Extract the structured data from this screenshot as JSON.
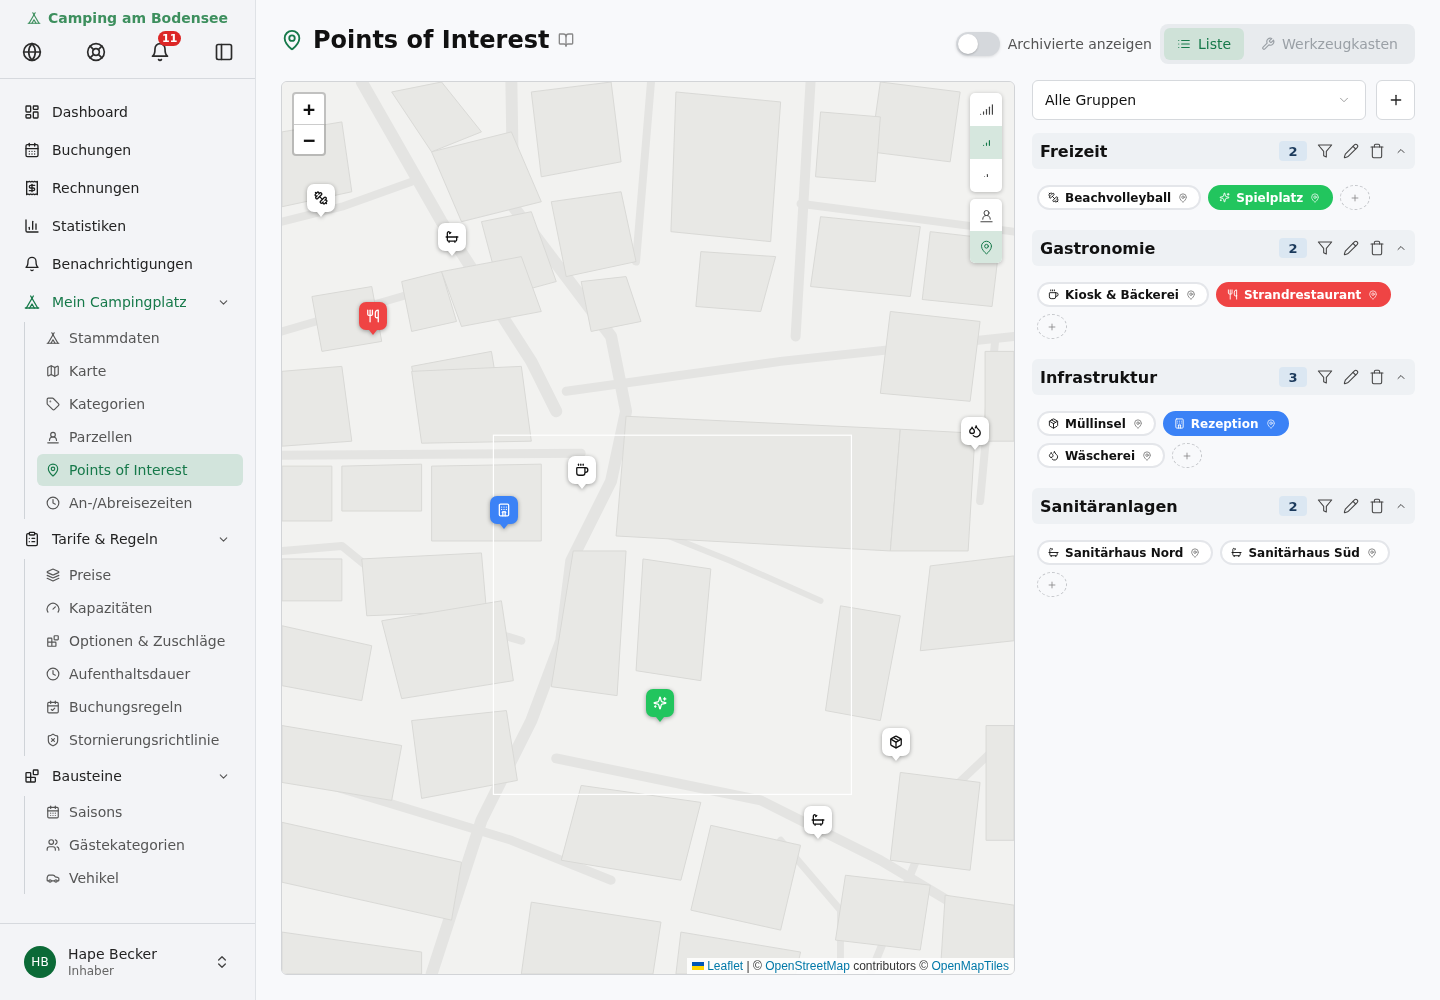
{
  "sidebar": {
    "brand": "Camping am Bodensee",
    "notification_count": "11",
    "nav": [
      {
        "label": "Dashboard",
        "selected": false
      },
      {
        "label": "Buchungen",
        "selected": false
      },
      {
        "label": "Rechnungen",
        "selected": false
      },
      {
        "label": "Statistiken",
        "selected": false
      },
      {
        "label": "Benachrichtigungen",
        "selected": false
      },
      {
        "label": "Mein Campingplatz",
        "selected": true,
        "expanded": true,
        "children": [
          {
            "label": "Stammdaten",
            "selected": false
          },
          {
            "label": "Karte",
            "selected": false
          },
          {
            "label": "Kategorien",
            "selected": false
          },
          {
            "label": "Parzellen",
            "selected": false
          },
          {
            "label": "Points of Interest",
            "selected": true
          },
          {
            "label": "An-/Abreisezeiten",
            "selected": false
          }
        ]
      },
      {
        "label": "Tarife & Regeln",
        "selected": false,
        "expanded": true,
        "children": [
          {
            "label": "Preise",
            "selected": false
          },
          {
            "label": "Kapazitäten",
            "selected": false
          },
          {
            "label": "Optionen & Zuschläge",
            "selected": false
          },
          {
            "label": "Aufenthaltsdauer",
            "selected": false
          },
          {
            "label": "Buchungsregeln",
            "selected": false
          },
          {
            "label": "Stornierungsrichtlinie",
            "selected": false
          }
        ]
      },
      {
        "label": "Bausteine",
        "selected": false,
        "expanded": true,
        "children": [
          {
            "label": "Saisons",
            "selected": false
          },
          {
            "label": "Gästekategorien",
            "selected": false
          },
          {
            "label": "Vehikel",
            "selected": false
          }
        ]
      }
    ],
    "user": {
      "initials": "HB",
      "name": "Hape Becker",
      "role": "Inhaber"
    }
  },
  "header": {
    "title": "Points of Interest",
    "archived_toggle": {
      "label": "Archivierte anzeigen",
      "on": false
    },
    "views": [
      {
        "label": "Liste",
        "selected": true
      },
      {
        "label": "Werkzeugkasten",
        "selected": false
      }
    ]
  },
  "map": {
    "zoom_in": "+",
    "zoom_out": "−",
    "detail_levels": [
      {
        "selected": false
      },
      {
        "selected": true
      },
      {
        "selected": false
      }
    ],
    "layers": [
      {
        "selected": false
      },
      {
        "selected": true
      }
    ],
    "markers": [
      {
        "color": "#ffffff"
      },
      {
        "color": "#ffffff"
      },
      {
        "color": "#ef4444"
      },
      {
        "color": "#ffffff"
      },
      {
        "color": "#ffffff"
      },
      {
        "color": "#3b82f6"
      },
      {
        "color": "#22c55e"
      },
      {
        "color": "#ffffff"
      },
      {
        "color": "#ffffff"
      }
    ],
    "attribution": [
      {
        "text": "Leaflet",
        "link": true
      },
      {
        "text": " | © ",
        "link": false
      },
      {
        "text": "OpenStreetMap",
        "link": true
      },
      {
        "text": " contributors © ",
        "link": false
      },
      {
        "text": "OpenMapTiles",
        "link": true
      }
    ]
  },
  "panel": {
    "group_filter": "Alle Gruppen",
    "groups": [
      {
        "title": "Freizeit",
        "count": "2",
        "expanded": true,
        "items": [
          {
            "label": "Beachvolleyball",
            "color": "#ffffff"
          },
          {
            "label": "Spielplatz",
            "color": "#22c55e"
          }
        ]
      },
      {
        "title": "Gastronomie",
        "count": "2",
        "expanded": true,
        "items": [
          {
            "label": "Kiosk & Bäckerei",
            "color": "#ffffff"
          },
          {
            "label": "Strandrestaurant",
            "color": "#ef4444"
          }
        ]
      },
      {
        "title": "Infrastruktur",
        "count": "3",
        "expanded": true,
        "items": [
          {
            "label": "Müllinsel",
            "color": "#ffffff"
          },
          {
            "label": "Rezeption",
            "color": "#3b82f6"
          },
          {
            "label": "Wäscherei",
            "color": "#ffffff"
          }
        ]
      },
      {
        "title": "Sanitäranlagen",
        "count": "2",
        "expanded": true,
        "items": [
          {
            "label": "Sanitärhaus Nord",
            "color": "#ffffff"
          },
          {
            "label": "Sanitärhaus Süd",
            "color": "#ffffff"
          }
        ]
      }
    ]
  }
}
